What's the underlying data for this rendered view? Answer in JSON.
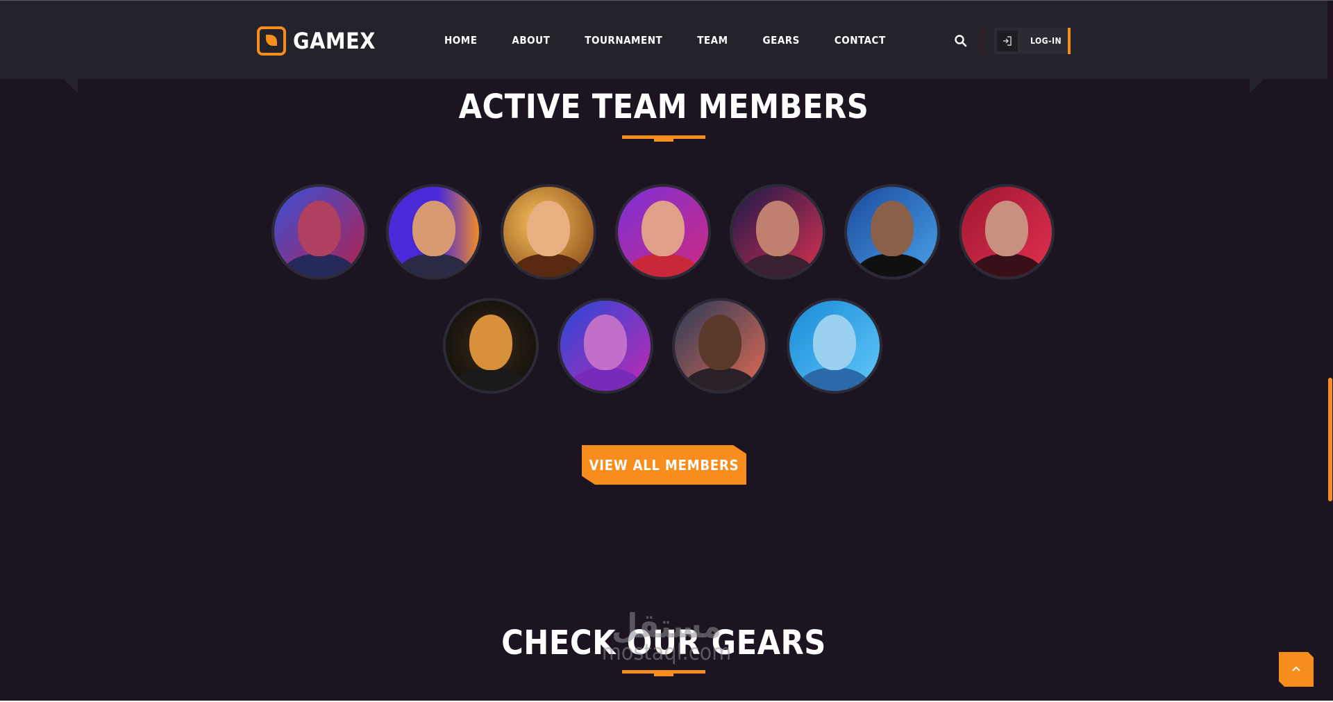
{
  "brand": {
    "name": "GAMEX",
    "accent": "#f78d1c",
    "background": "#1c1420",
    "header_bg": "#24222a"
  },
  "nav": {
    "items": [
      {
        "label": "HOME"
      },
      {
        "label": "ABOUT"
      },
      {
        "label": "TOURNAMENT"
      },
      {
        "label": "TEAM"
      },
      {
        "label": "GEARS"
      },
      {
        "label": "CONTACT"
      }
    ],
    "search_icon": "search-icon",
    "login_icon": "login-icon",
    "login_label": "LOG-IN"
  },
  "team": {
    "title": "ACTIVE TEAM MEMBERS",
    "members_row1": [
      {
        "bg": "linear-gradient(135deg,#3a4fd8,#b3224e)",
        "face": "#b04060",
        "body": "#262a5a"
      },
      {
        "bg": "linear-gradient(90deg,#4a2ad8 55%,#f08c28)",
        "face": "#d89a70",
        "body": "#2a2a44"
      },
      {
        "bg": "radial-gradient(circle at 40% 40%,#f7c25a,#7a3a10)",
        "face": "#e8b080",
        "body": "#5a2a10"
      },
      {
        "bg": "linear-gradient(135deg,#7a30d8,#d02a80)",
        "face": "#e0a088",
        "body": "#c82838"
      },
      {
        "bg": "linear-gradient(135deg,#1a1a4a,#d83050)",
        "face": "#c08070",
        "body": "#3a2030"
      },
      {
        "bg": "linear-gradient(135deg,#1a4a9a,#4aa0e8)",
        "face": "#8a6048",
        "body": "#101010"
      },
      {
        "bg": "linear-gradient(135deg,#a01830,#e03050)",
        "face": "#c89080",
        "body": "#3a1018"
      }
    ],
    "members_row2": [
      {
        "bg": "radial-gradient(circle at 50% 50%,#3a2a18,#0a0a0a)",
        "face": "#d8903a",
        "body": "#1a1a1a"
      },
      {
        "bg": "linear-gradient(135deg,#2a48d8,#c02ab0)",
        "face": "#c070c8",
        "body": "#7a2ab8"
      },
      {
        "bg": "linear-gradient(135deg,#2a3a5a,#e06a50)",
        "face": "#5a3a2a",
        "body": "#2a2028"
      },
      {
        "bg": "linear-gradient(135deg,#1a8ad8,#60c8f8)",
        "face": "#9ad0f0",
        "body": "#2a6aa8"
      }
    ],
    "button_label": "VIEW ALL MEMBERS"
  },
  "gears": {
    "title": "CHECK OUR GEARS"
  },
  "scroll_top_icon": "chevron-up-icon",
  "watermark": {
    "arabic": "مستقل",
    "latin": "mostaql.com"
  }
}
